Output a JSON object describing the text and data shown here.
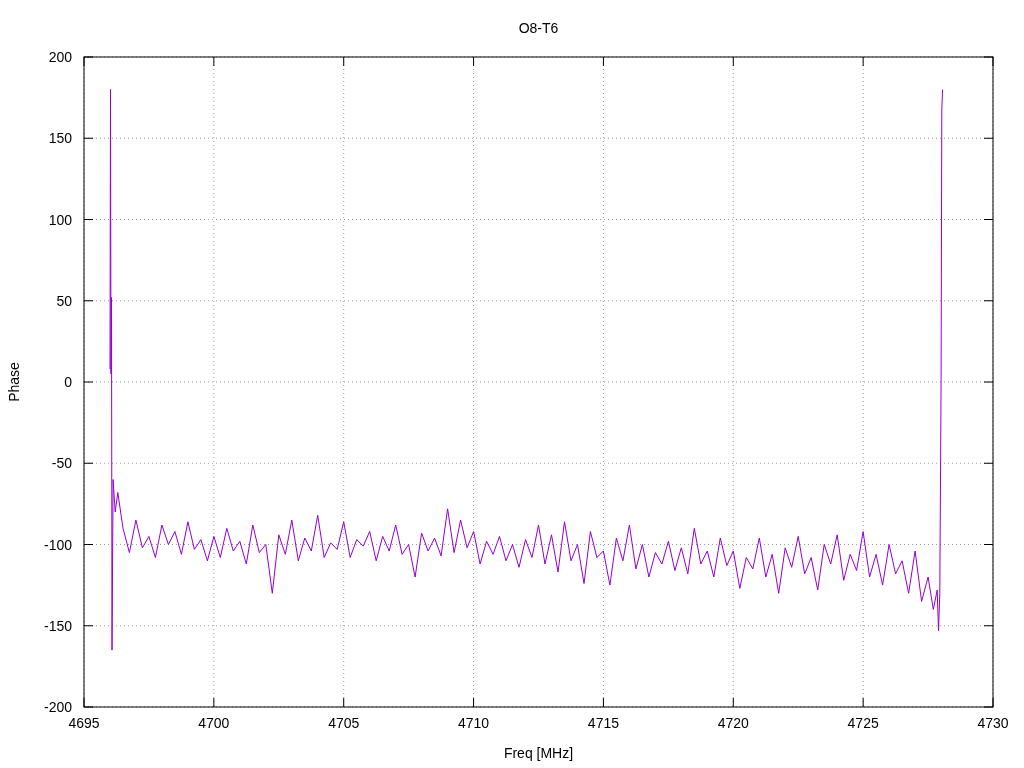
{
  "chart_data": {
    "type": "line",
    "title": "O8-T6",
    "xlabel": "Freq [MHz]",
    "ylabel": "Phase",
    "x": [
      4696.0,
      4696.02,
      4696.04,
      4696.06,
      4696.08,
      4696.12,
      4696.2,
      4696.3,
      4696.5,
      4696.75,
      4697,
      4697.25,
      4697.5,
      4697.75,
      4698,
      4698.25,
      4698.5,
      4698.75,
      4699,
      4699.25,
      4699.5,
      4699.75,
      4700,
      4700.25,
      4700.5,
      4700.75,
      4701,
      4701.25,
      4701.5,
      4701.75,
      4702,
      4702.25,
      4702.5,
      4702.75,
      4703,
      4703.25,
      4703.5,
      4703.75,
      4704,
      4704.25,
      4704.5,
      4704.75,
      4705,
      4705.25,
      4705.5,
      4705.75,
      4706,
      4706.25,
      4706.5,
      4706.75,
      4707,
      4707.25,
      4707.5,
      4707.75,
      4708,
      4708.25,
      4708.5,
      4708.75,
      4709,
      4709.25,
      4709.5,
      4709.75,
      4710,
      4710.25,
      4710.5,
      4710.75,
      4711,
      4711.25,
      4711.5,
      4711.75,
      4712,
      4712.25,
      4712.5,
      4712.75,
      4713,
      4713.25,
      4713.5,
      4713.75,
      4714,
      4714.25,
      4714.5,
      4714.75,
      4715,
      4715.25,
      4715.5,
      4715.75,
      4716,
      4716.25,
      4716.5,
      4716.75,
      4717,
      4717.25,
      4717.5,
      4717.75,
      4718,
      4718.25,
      4718.5,
      4718.75,
      4719,
      4719.25,
      4719.5,
      4719.75,
      4720,
      4720.25,
      4720.5,
      4720.75,
      4721,
      4721.25,
      4721.5,
      4721.75,
      4722,
      4722.25,
      4722.5,
      4722.75,
      4723,
      4723.25,
      4723.5,
      4723.75,
      4724,
      4724.25,
      4724.5,
      4724.75,
      4725,
      4725.25,
      4725.5,
      4725.75,
      4726,
      4726.25,
      4726.5,
      4726.75,
      4727,
      4727.25,
      4727.5,
      4727.7,
      4727.85,
      4727.9,
      4727.95,
      4728.0,
      4728.03,
      4728.06
    ],
    "series": [
      {
        "color": "#9400d3",
        "values": [
          8,
          180,
          5,
          52,
          -165,
          -60,
          -80,
          -68,
          -90,
          -105,
          -85,
          -102,
          -95,
          -108,
          -88,
          -100,
          -92,
          -106,
          -86,
          -103,
          -97,
          -110,
          -95,
          -108,
          -90,
          -104,
          -98,
          -112,
          -88,
          -105,
          -100,
          -130,
          -94,
          -106,
          -85,
          -110,
          -96,
          -104,
          -82,
          -108,
          -99,
          -103,
          -86,
          -108,
          -97,
          -101,
          -92,
          -110,
          -95,
          -104,
          -88,
          -106,
          -100,
          -120,
          -93,
          -104,
          -96,
          -107,
          -78,
          -105,
          -85,
          -102,
          -92,
          -112,
          -98,
          -106,
          -95,
          -110,
          -100,
          -114,
          -97,
          -108,
          -88,
          -112,
          -94,
          -117,
          -86,
          -110,
          -100,
          -124,
          -92,
          -108,
          -104,
          -125,
          -96,
          -110,
          -88,
          -115,
          -100,
          -120,
          -105,
          -112,
          -98,
          -116,
          -102,
          -118,
          -90,
          -112,
          -104,
          -120,
          -96,
          -113,
          -104,
          -127,
          -108,
          -115,
          -96,
          -120,
          -106,
          -130,
          -102,
          -114,
          -95,
          -118,
          -108,
          -128,
          -100,
          -112,
          -94,
          -122,
          -106,
          -116,
          -92,
          -120,
          -106,
          -125,
          -100,
          -118,
          -110,
          -130,
          -104,
          -135,
          -120,
          -140,
          -128,
          -153,
          -130,
          2,
          168,
          180
        ]
      }
    ],
    "xlim": [
      4695,
      4730
    ],
    "ylim": [
      -200,
      200
    ],
    "xticks": [
      4695,
      4700,
      4705,
      4710,
      4715,
      4720,
      4725,
      4730
    ],
    "yticks": [
      -200,
      -150,
      -100,
      -50,
      0,
      50,
      100,
      150,
      200
    ],
    "grid": true
  }
}
